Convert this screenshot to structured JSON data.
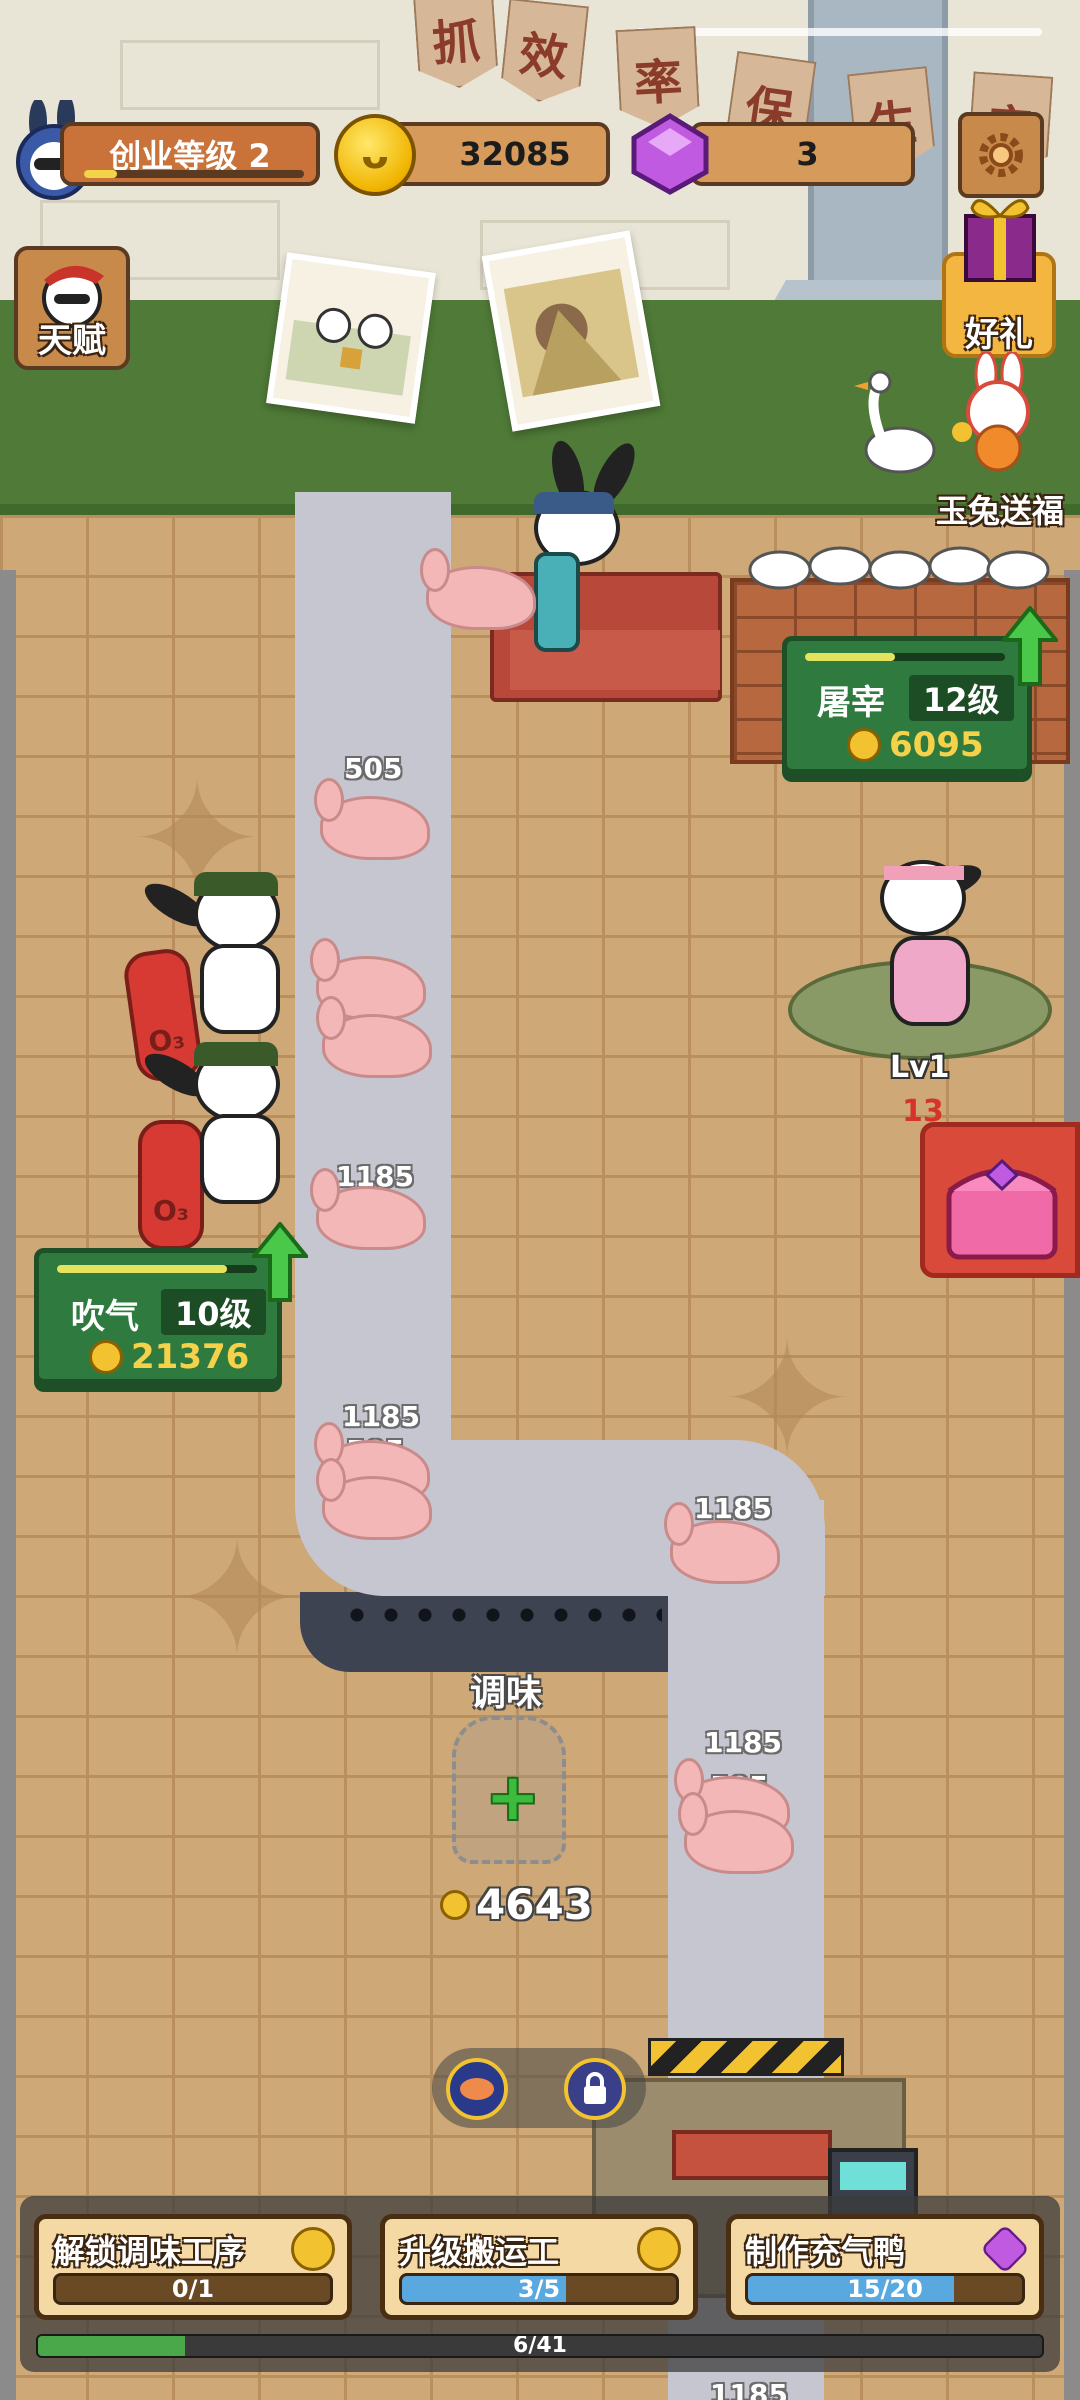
{
  "hud": {
    "level_label": "创业等级 2",
    "level_progress": 0.15,
    "coins": "32085",
    "gems": "3",
    "avatar_icon": "bunny-avatar-icon",
    "settings_icon": "gear-icon"
  },
  "side_buttons": {
    "talent": "天赋",
    "gift": "好礼",
    "rabbit_blessing": "玉兔送福"
  },
  "banner_chars": [
    "抓",
    "效",
    "率",
    "保",
    "生",
    "产"
  ],
  "stations": {
    "slaughter": {
      "name": "屠宰",
      "level": "12级",
      "cost": "6095",
      "progress": 0.45
    },
    "inflate": {
      "name": "吹气",
      "level": "10级",
      "cost": "21376",
      "progress": 0.85
    },
    "pedestal": {
      "level": "Lv1",
      "count": "13"
    },
    "seasoning": {
      "name": "调味",
      "cost": "4643"
    }
  },
  "belt_labels": {
    "d1": "505",
    "d2": "1185",
    "d3a": "1185",
    "d3b": "505",
    "d4": "1185",
    "d5a": "1185",
    "d5b": "505",
    "d6": "1185"
  },
  "tasks": [
    {
      "title": "解锁调味工序",
      "progress_text": "0/1",
      "progress": 0.0,
      "reward_icon": "coin-icon"
    },
    {
      "title": "升级搬运工",
      "progress_text": "3/5",
      "progress": 0.6,
      "reward_icon": "coin-icon"
    },
    {
      "title": "制作充气鸭",
      "progress_text": "15/20",
      "progress": 0.75,
      "reward_icon": "gem-icon"
    }
  ],
  "overall_progress": {
    "text": "6/41",
    "value": 0.146
  },
  "colors": {
    "belt": "#c6c6d1",
    "station_card": "#2f7a3e",
    "coin": "#f2c230",
    "gem": "#c05ae0"
  }
}
